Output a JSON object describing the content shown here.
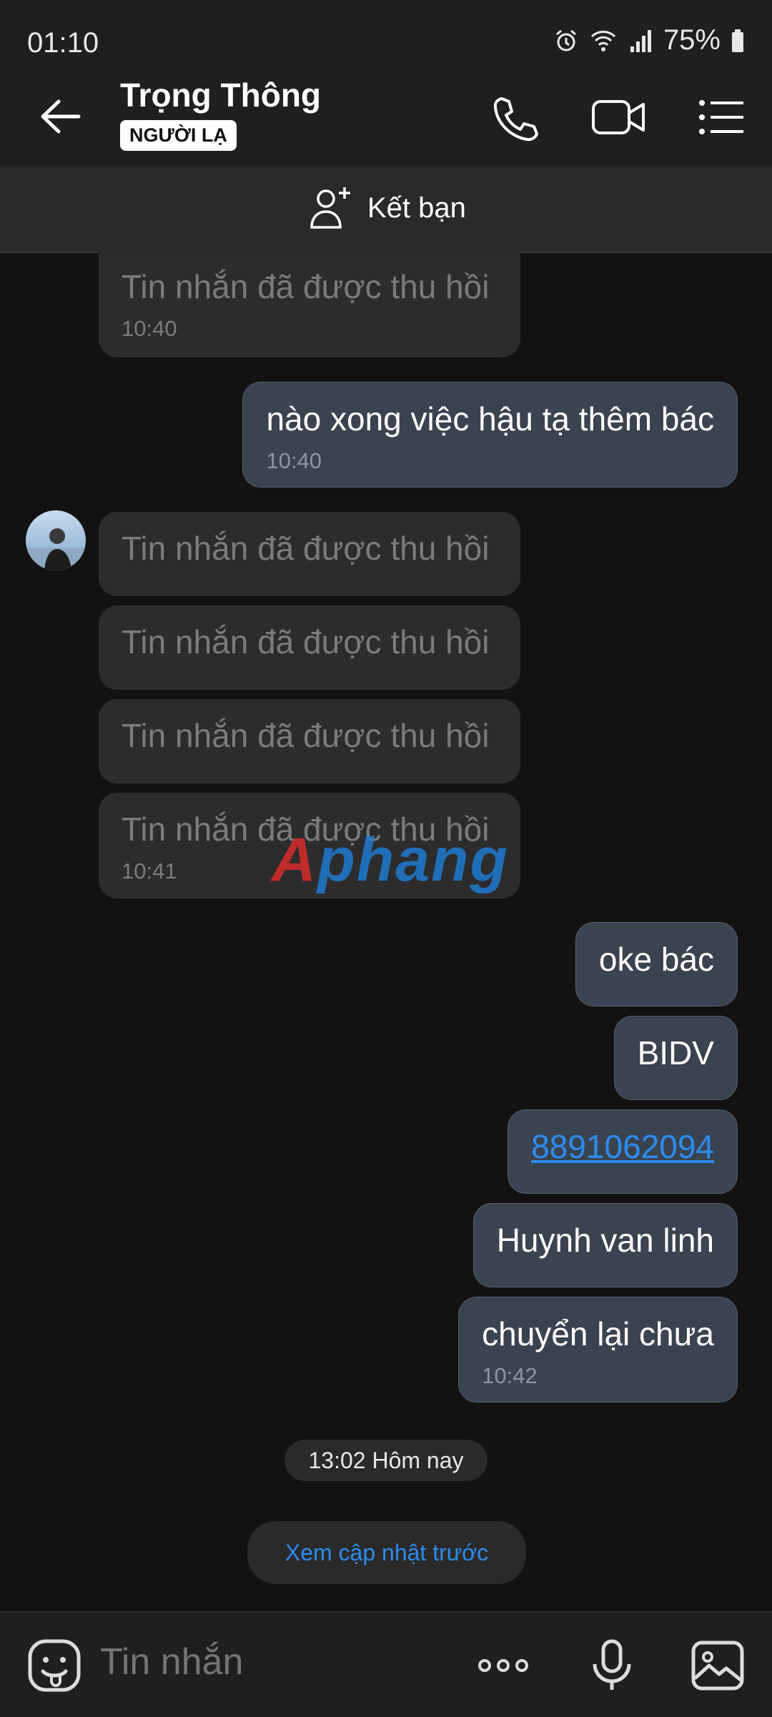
{
  "status_bar": {
    "time": "01:10",
    "battery": "75%"
  },
  "header": {
    "name": "Trọng Thông",
    "badge": "NGƯỜI LẠ"
  },
  "add_friend": {
    "label": "Kết bạn"
  },
  "messages": [
    {
      "side": "received",
      "text": "Tin nhắn đã được thu hồi",
      "time": "10:40"
    },
    {
      "side": "sent",
      "text": "nào xong việc hậu tạ thêm bác",
      "time": "10:40"
    },
    {
      "side": "received",
      "text": "Tin nhắn đã được thu hồi"
    },
    {
      "side": "received",
      "text": "Tin nhắn đã được thu hồi"
    },
    {
      "side": "received",
      "text": "Tin nhắn đã được thu hồi"
    },
    {
      "side": "received",
      "text": "Tin nhắn đã được thu hồi",
      "time": "10:41"
    },
    {
      "side": "sent",
      "text": "oke bác"
    },
    {
      "side": "sent",
      "text": "BIDV"
    },
    {
      "side": "sent",
      "text": "8891062094"
    },
    {
      "side": "sent",
      "text": "Huynh van linh"
    },
    {
      "side": "sent",
      "text": "chuyển lại chưa",
      "time": "10:42"
    }
  ],
  "watermark": {
    "first": "A",
    "rest": "phang"
  },
  "date_divider": "13:02 Hôm nay",
  "update_button": "Xem cập nhật trước",
  "composer": {
    "placeholder": "Tin nhắn"
  },
  "colors": {
    "link": "#2d8cf0",
    "sent_bubble": "#3a4350",
    "received_bubble": "#2c2c2c"
  }
}
